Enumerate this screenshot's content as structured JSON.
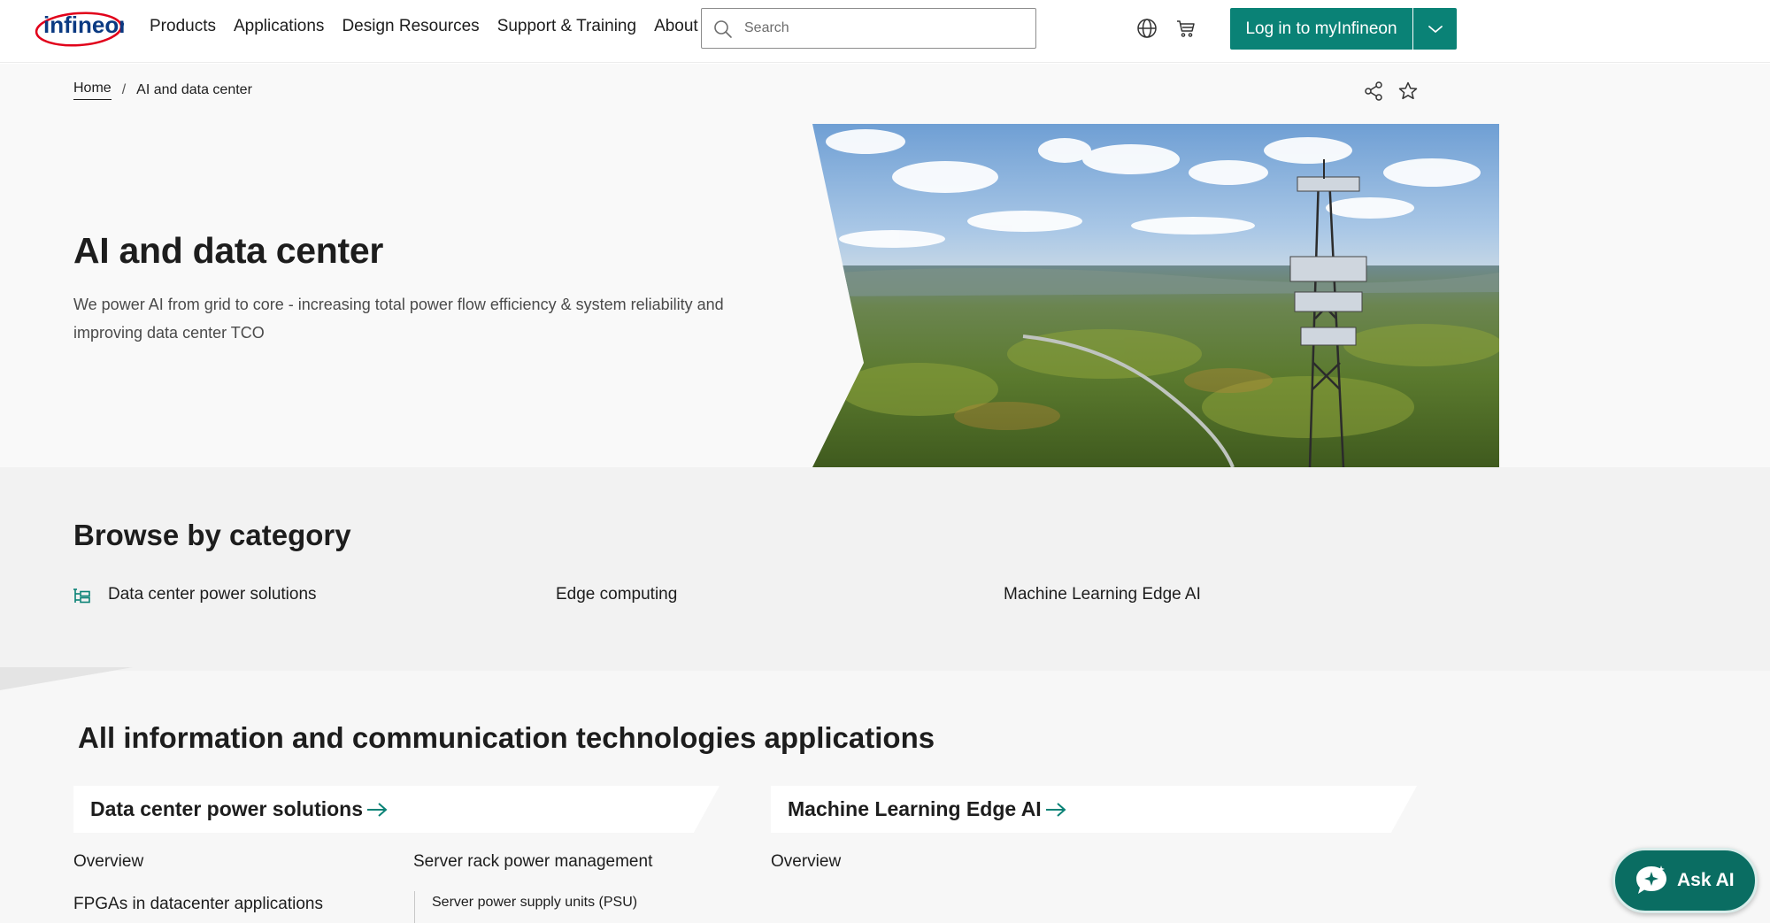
{
  "header": {
    "logo_text": "infineon",
    "nav": [
      "Products",
      "Applications",
      "Design Resources",
      "Support & Training",
      "About"
    ],
    "search_placeholder": "Search",
    "login_label": "Log in to myInfineon",
    "icons": [
      "globe-icon",
      "cart-icon",
      "chevron-down-icon",
      "search-icon"
    ],
    "accent_color": "#0a8276"
  },
  "breadcrumb": {
    "home": "Home",
    "separator": "/",
    "current": "AI and data center"
  },
  "hero": {
    "title": "AI and data center",
    "subtitle": "We power AI from grid to core - increasing total power flow efficiency & system reliability and improving data center TCO"
  },
  "browse": {
    "title": "Browse by category",
    "categories": [
      "Data center power solutions",
      "Edge computing",
      "Machine Learning Edge AI"
    ]
  },
  "applications": {
    "title": "All information and communication technologies applications",
    "cards": [
      {
        "label": "Data center power solutions",
        "col1": [
          "Overview",
          "FPGAs in datacenter applications"
        ],
        "col2_heading": "Server rack power management",
        "col2_items": [
          "Server power supply units (PSU)"
        ]
      },
      {
        "label": "Machine Learning Edge AI",
        "col1": [
          "Overview"
        ]
      }
    ]
  },
  "ask_ai": {
    "label": "Ask AI"
  }
}
